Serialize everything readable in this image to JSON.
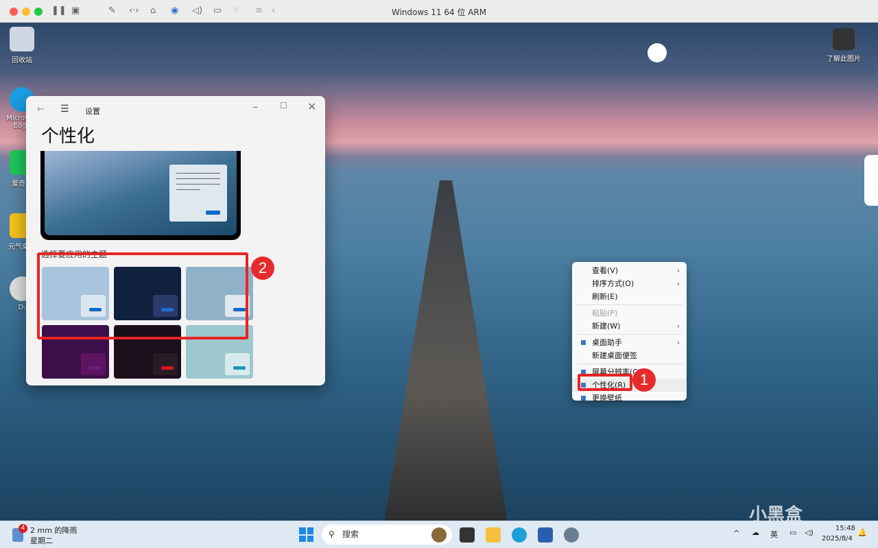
{
  "window": {
    "title": "Windows 11 64 位 ARM"
  },
  "toolbar": {
    "icons": [
      "pause-icon",
      "snapshot-icon",
      "wrench-icon",
      "code-icon",
      "drive-icon",
      "camera-user-icon",
      "speaker-icon",
      "video-icon",
      "usb-icon",
      "list-icon",
      "chevron-left-icon"
    ]
  },
  "desktop": {
    "icons": [
      {
        "label": "回收站"
      },
      {
        "label": "Microsoft Edge"
      },
      {
        "label": "爱奇艺"
      },
      {
        "label": "元气桌面"
      },
      {
        "label": "D:"
      }
    ],
    "learn_label": "了解此图片"
  },
  "settings": {
    "app_title": "设置",
    "page_title": "个性化",
    "section_label": "选择要应用的主题",
    "themes": [
      {
        "bg": "#a9c4de",
        "chip": "#dbe6f0",
        "btn": "#1068c8"
      },
      {
        "bg": "#10203f",
        "chip": "#2a3b6b",
        "btn": "#1c6fd0"
      },
      {
        "bg": "#8fb2c8",
        "chip": "#dfe8ef",
        "btn": "#1068c8"
      },
      {
        "bg": "#3d0f4a",
        "chip": "#5e1460",
        "btn": "#6a1d80"
      },
      {
        "bg": "#1a0f1a",
        "chip": "#2b1b24",
        "btn": "#d81a1a"
      },
      {
        "bg": "#9dc8d0",
        "chip": "#d9eaee",
        "btn": "#1a9aae"
      }
    ]
  },
  "context_menu": {
    "items": [
      {
        "label": "查看(V)",
        "submenu": true
      },
      {
        "label": "排序方式(O)",
        "submenu": true
      },
      {
        "label": "刷新(E)"
      },
      {
        "label": "粘贴(P)",
        "disabled": true
      },
      {
        "label": "新建(W)",
        "submenu": true
      },
      {
        "label": "桌面助手",
        "submenu": true,
        "icon": true
      },
      {
        "label": "新建桌面便签"
      },
      {
        "label": "屏幕分辨率(C)",
        "icon": true
      },
      {
        "label": "个性化(R)",
        "icon": true
      },
      {
        "label": "更换壁纸",
        "icon": true
      }
    ]
  },
  "annotations": {
    "one": "1",
    "two": "2",
    "color": "#e52b2b"
  },
  "taskbar": {
    "weather_badge": "4",
    "weather": "2 mm 的降雨",
    "day": "星期二",
    "search_placeholder": "搜索",
    "ime": "英",
    "time": "15:48",
    "date": "2025/8/4"
  },
  "watermark": "小黑盒"
}
